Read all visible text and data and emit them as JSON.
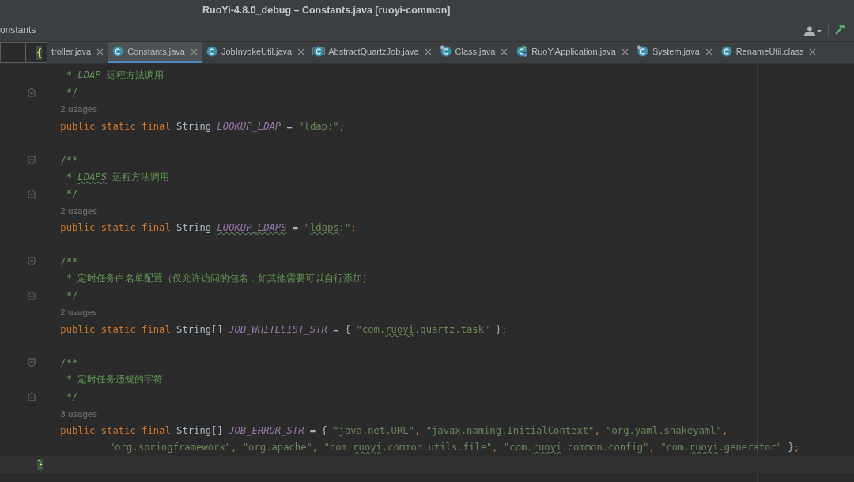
{
  "window": {
    "title": "RuoYi-4.8.0_debug – Constants.java [ruoyi-common]"
  },
  "breadcrumb": "onstants",
  "preview": {
    "text": "{"
  },
  "tabs": [
    {
      "label": "troller.java",
      "kind": "none",
      "selected": false
    },
    {
      "label": "Constants.java",
      "kind": "class",
      "selected": true
    },
    {
      "label": "JobInvokeUtil.java",
      "kind": "class",
      "selected": false
    },
    {
      "label": "AbstractQuartzJob.java",
      "kind": "abstract",
      "selected": false
    },
    {
      "label": "Class.java",
      "kind": "locked",
      "selected": false
    },
    {
      "label": "RuoYiApplication.java",
      "kind": "run",
      "selected": false
    },
    {
      "label": "System.java",
      "kind": "locked",
      "selected": false
    },
    {
      "label": "RenameUtil.class",
      "kind": "class",
      "selected": false
    }
  ],
  "lines": [
    {
      "kind": "doc",
      "tokens": [
        {
          "kind": "comment",
          "text": " * "
        },
        {
          "kind": "tag",
          "text": "LDAP"
        },
        {
          "kind": "comment",
          "text": " 远程方法调用"
        }
      ]
    },
    {
      "kind": "doc",
      "fold_end": true,
      "tokens": [
        {
          "kind": "comment",
          "text": " */"
        }
      ]
    },
    {
      "kind": "hint",
      "tokens": [
        {
          "kind": "hint",
          "text": "2 usages"
        }
      ]
    },
    {
      "kind": "member",
      "tokens": [
        {
          "kind": "kw",
          "text": "public static final "
        },
        {
          "kind": "type",
          "text": "String "
        },
        {
          "kind": "field",
          "text": "LOOKUP_LDAP"
        },
        {
          "kind": "op",
          "text": " = "
        },
        {
          "kind": "str",
          "text": "\"ldap:\""
        },
        {
          "kind": "punct",
          "text": ";"
        }
      ]
    },
    {
      "kind": "blank"
    },
    {
      "kind": "doc",
      "fold_start": true,
      "tokens": [
        {
          "kind": "comment",
          "text": "/**"
        }
      ]
    },
    {
      "kind": "doc",
      "tokens": [
        {
          "kind": "comment",
          "text": " * "
        },
        {
          "kind": "tag",
          "text": "LDAPS",
          "typo": true
        },
        {
          "kind": "comment",
          "text": " 远程方法调用"
        }
      ]
    },
    {
      "kind": "doc",
      "fold_end": true,
      "tokens": [
        {
          "kind": "comment",
          "text": " */"
        }
      ]
    },
    {
      "kind": "hint",
      "tokens": [
        {
          "kind": "hint",
          "text": "2 usages"
        }
      ]
    },
    {
      "kind": "member",
      "tokens": [
        {
          "kind": "kw",
          "text": "public static final "
        },
        {
          "kind": "type",
          "text": "String "
        },
        {
          "kind": "field",
          "text": "LOOKUP_LDAPS",
          "typo": true
        },
        {
          "kind": "op",
          "text": " = "
        },
        {
          "kind": "str",
          "text": "\""
        },
        {
          "kind": "str",
          "text": "ldaps",
          "typo": true
        },
        {
          "kind": "str",
          "text": ":\""
        },
        {
          "kind": "punct",
          "text": ";"
        }
      ]
    },
    {
      "kind": "blank"
    },
    {
      "kind": "doc",
      "fold_start": true,
      "tokens": [
        {
          "kind": "comment",
          "text": "/**"
        }
      ]
    },
    {
      "kind": "doc",
      "tokens": [
        {
          "kind": "comment",
          "text": " * 定时任务白名单配置（仅允许访问的包名，如其他需要可以自行添加）"
        }
      ]
    },
    {
      "kind": "doc",
      "fold_end": true,
      "tokens": [
        {
          "kind": "comment",
          "text": " */"
        }
      ]
    },
    {
      "kind": "hint",
      "tokens": [
        {
          "kind": "hint",
          "text": "2 usages"
        }
      ]
    },
    {
      "kind": "member",
      "tokens": [
        {
          "kind": "kw",
          "text": "public static final "
        },
        {
          "kind": "type",
          "text": "String[] "
        },
        {
          "kind": "field",
          "text": "JOB_WHITELIST_STR"
        },
        {
          "kind": "op",
          "text": " = { "
        },
        {
          "kind": "str",
          "text": "\"com."
        },
        {
          "kind": "str",
          "text": "ruoyi",
          "typo": true
        },
        {
          "kind": "str",
          "text": ".quartz.task\""
        },
        {
          "kind": "op",
          "text": " }"
        },
        {
          "kind": "punct",
          "text": ";"
        }
      ]
    },
    {
      "kind": "blank"
    },
    {
      "kind": "doc",
      "fold_start": true,
      "tokens": [
        {
          "kind": "comment",
          "text": "/**"
        }
      ]
    },
    {
      "kind": "doc",
      "tokens": [
        {
          "kind": "comment",
          "text": " * 定时任务违规的字符"
        }
      ]
    },
    {
      "kind": "doc",
      "fold_end": true,
      "tokens": [
        {
          "kind": "comment",
          "text": " */"
        }
      ]
    },
    {
      "kind": "hint",
      "tokens": [
        {
          "kind": "hint",
          "text": "3 usages"
        }
      ]
    },
    {
      "kind": "member",
      "tokens": [
        {
          "kind": "kw",
          "text": "public static final "
        },
        {
          "kind": "type",
          "text": "String[] "
        },
        {
          "kind": "field",
          "text": "JOB_ERROR_STR"
        },
        {
          "kind": "op",
          "text": " = { "
        },
        {
          "kind": "str",
          "text": "\"java.net.URL\""
        },
        {
          "kind": "punct",
          "text": ", "
        },
        {
          "kind": "str",
          "text": "\"javax.naming.InitialContext\""
        },
        {
          "kind": "punct",
          "text": ", "
        },
        {
          "kind": "str",
          "text": "\"org.yaml.snakeyaml\""
        },
        {
          "kind": "punct",
          "text": ","
        }
      ]
    },
    {
      "kind": "continuation",
      "tokens": [
        {
          "kind": "str",
          "text": "\"org.springframework\""
        },
        {
          "kind": "punct",
          "text": ", "
        },
        {
          "kind": "str",
          "text": "\"org.apache\""
        },
        {
          "kind": "punct",
          "text": ", "
        },
        {
          "kind": "str",
          "text": "\"com."
        },
        {
          "kind": "str",
          "text": "ruoyi",
          "typo": true
        },
        {
          "kind": "str",
          "text": ".common.utils.file\""
        },
        {
          "kind": "punct",
          "text": ", "
        },
        {
          "kind": "str",
          "text": "\"com."
        },
        {
          "kind": "str",
          "text": "ruoyi",
          "typo": true
        },
        {
          "kind": "str",
          "text": ".common.config\""
        },
        {
          "kind": "punct",
          "text": ", "
        },
        {
          "kind": "str",
          "text": "\"com."
        },
        {
          "kind": "str",
          "text": "ruoyi",
          "typo": true
        },
        {
          "kind": "str",
          "text": ".generator\""
        },
        {
          "kind": "op",
          "text": " }"
        },
        {
          "kind": "punct",
          "text": ";"
        }
      ]
    },
    {
      "kind": "brace",
      "current": true,
      "tokens": [
        {
          "kind": "match",
          "text": "}"
        }
      ]
    }
  ]
}
